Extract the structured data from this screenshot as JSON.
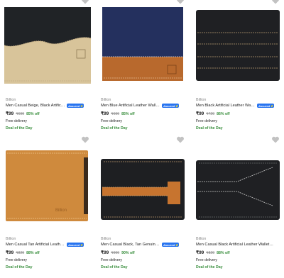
{
  "products": [
    {
      "brand": "Billion",
      "title": "Men Casual Beige, Black Artificial Leather Wallet",
      "price": "₹99",
      "mrp": "₹699",
      "off": "85% off",
      "delivery": "Free delivery",
      "deal": "Deal of the Day",
      "assured": "Assured"
    },
    {
      "brand": "Billion",
      "title": "Men Blue Artificial Leather Wallet - Mini",
      "price": "₹99",
      "mrp": "₹699",
      "off": "85% off",
      "delivery": "Free delivery",
      "deal": "Deal of the Day",
      "assured": "Assured"
    },
    {
      "brand": "Billion",
      "title": "Men Black Artificial Leather Wallet - Mini",
      "price": "₹99",
      "mrp": "₹729",
      "off": "86% off",
      "delivery": "Free delivery",
      "deal": "Deal of the Day",
      "assured": "Assured"
    },
    {
      "brand": "Billion",
      "title": "Men Casual Tan Artificial Leather Wallet - Mini",
      "price": "₹99",
      "mrp": "₹829",
      "off": "88% off",
      "delivery": "Free delivery",
      "deal": "Deal of the Day",
      "assured": "Assured"
    },
    {
      "brand": "Billion",
      "title": "Men Casual Black, Tan Genuine Leather Wallet",
      "price": "₹99",
      "mrp": "₹999",
      "off": "90% off",
      "delivery": "Free delivery",
      "deal": "Deal of the Day",
      "assured": "Assured"
    },
    {
      "brand": "Billion",
      "title": "Men Casual Black Artificial Leather Wallet - Mini",
      "price": "₹99",
      "mrp": "₹829",
      "off": "88% off",
      "delivery": "Free delivery",
      "deal": "Deal of the Day",
      "assured": ""
    }
  ],
  "embossed_brand_text": "Billion",
  "colors": {
    "accent": "#2874f0",
    "discount": "#388e3c",
    "muted": "#878787"
  }
}
